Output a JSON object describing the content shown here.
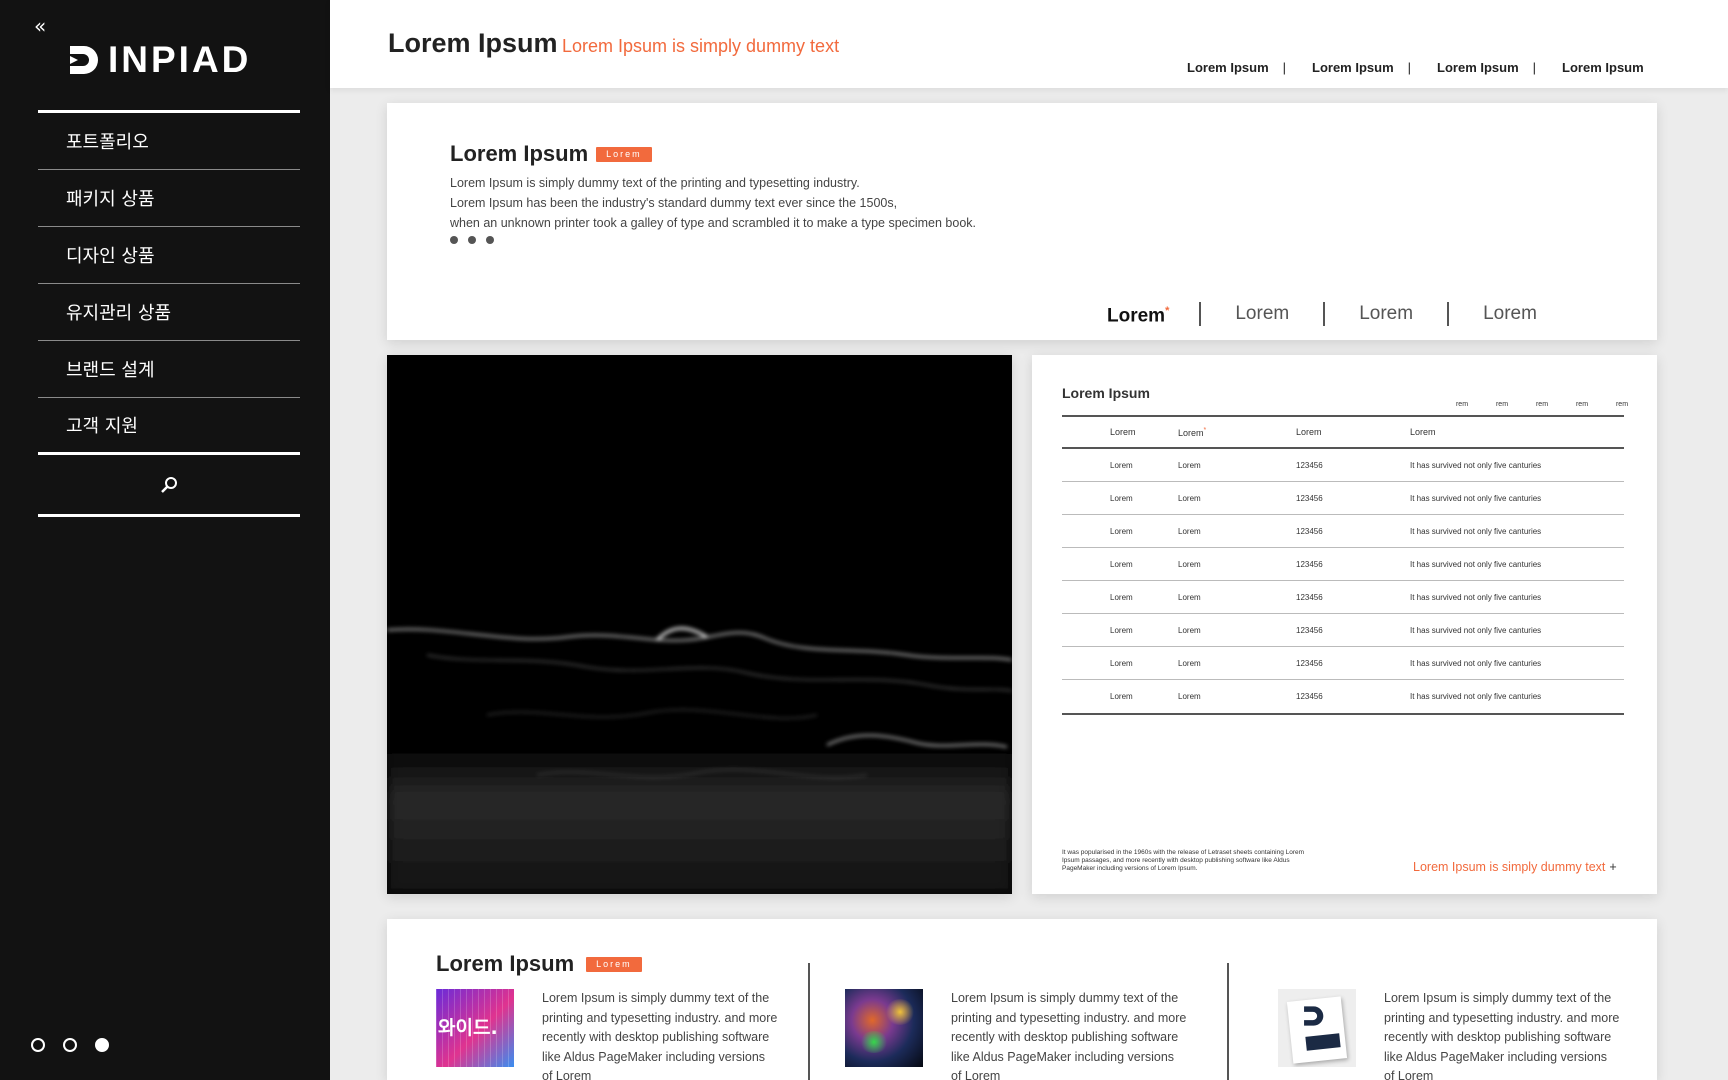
{
  "sidebar": {
    "brand": "INPIAD",
    "items": [
      {
        "label": "포트폴리오"
      },
      {
        "label": "패키지 상품"
      },
      {
        "label": "디자인 상품"
      },
      {
        "label": "유지관리 상품"
      },
      {
        "label": "브랜드 설계"
      },
      {
        "label": "고객 지원"
      }
    ]
  },
  "header": {
    "title": "Lorem Ipsum",
    "subtitle": "Lorem Ipsum is simply dummy text",
    "links": [
      "Lorem Ipsum",
      "Lorem Ipsum",
      "Lorem Ipsum",
      "Lorem Ipsum"
    ],
    "separator": "|"
  },
  "intro": {
    "title": "Lorem Ipsum",
    "badge": "Lorem",
    "lines": [
      "Lorem Ipsum is simply dummy text of the printing and typesetting industry.",
      "Lorem Ipsum has been the industry's standard dummy text ever since the 1500s,",
      "when an unknown printer took a galley of type and scrambled it to make a type specimen book."
    ],
    "tabs": [
      "Lorem",
      "Lorem",
      "Lorem",
      "Lorem"
    ],
    "tab_mark": "*"
  },
  "table_card": {
    "title": "Lorem Ipsum",
    "mini_labels": [
      "rem",
      "rem",
      "rem",
      "rem",
      "rem"
    ],
    "headers": [
      "Lorem",
      "Lorem",
      "Lorem",
      "Lorem"
    ],
    "header_mark": "*",
    "rows": [
      [
        "Lorem",
        "Lorem",
        "123456",
        "It has survived not only five canturies"
      ],
      [
        "Lorem",
        "Lorem",
        "123456",
        "It has survived not only five canturies"
      ],
      [
        "Lorem",
        "Lorem",
        "123456",
        "It has survived not only five canturies"
      ],
      [
        "Lorem",
        "Lorem",
        "123456",
        "It has survived not only five canturies"
      ],
      [
        "Lorem",
        "Lorem",
        "123456",
        "It has survived not only five canturies"
      ],
      [
        "Lorem",
        "Lorem",
        "123456",
        "It has survived not only five canturies"
      ],
      [
        "Lorem",
        "Lorem",
        "123456",
        "It has survived not only five canturies"
      ],
      [
        "Lorem",
        "Lorem",
        "123456",
        "It has survived not only five canturies"
      ]
    ],
    "footnote": "It was popularised in the 1960s with the release of Letraset sheets containing Lorem Ipsum passages, and more recently with desktop publishing software like Aldus PageMaker including versions of Lorem Ipsum.",
    "link": "Lorem Ipsum is simply dummy text",
    "link_plus": "+"
  },
  "bottom": {
    "title": "Lorem Ipsum",
    "badge": "Lorem",
    "items": [
      {
        "thumb_text": "와이드.",
        "text": "Lorem Ipsum is simply dummy text of the printing and typesetting industry. and more recently with desktop publishing software like Aldus PageMaker including versions of Lorem"
      },
      {
        "text": "Lorem Ipsum is simply dummy text of the printing and typesetting industry. and more recently with desktop publishing software like Aldus PageMaker including versions of Lorem"
      },
      {
        "text": "Lorem Ipsum is simply dummy text of the printing and typesetting industry. and more recently with desktop publishing software like Aldus PageMaker including versions of Lorem"
      }
    ]
  },
  "colors": {
    "accent": "#f26a3d",
    "sidebar_bg": "#121212",
    "page_bg": "#ececec"
  },
  "icons": {
    "collapse": "double-chevron-left-icon",
    "search": "search-icon"
  },
  "pagination": {
    "count": 3,
    "active": 3
  }
}
